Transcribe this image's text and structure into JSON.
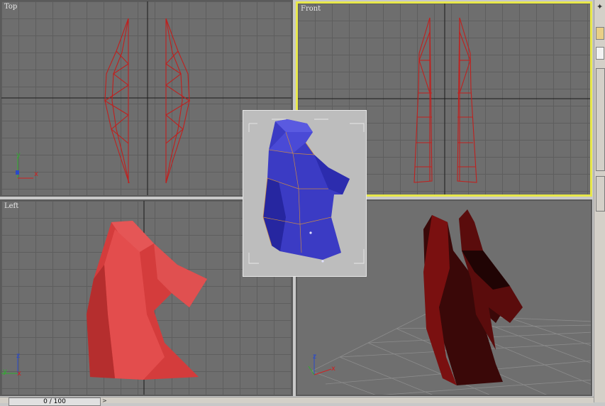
{
  "viewports": {
    "top": {
      "label": "Top"
    },
    "front": {
      "label": "Front"
    },
    "left": {
      "label": "Left"
    },
    "perspective": {
      "label": ""
    }
  },
  "axes": {
    "top": {
      "v": "y",
      "h": "x"
    },
    "left": {
      "v": "z",
      "h": "y"
    },
    "perspective": {
      "v": "z",
      "h": "x"
    }
  },
  "timeslider": {
    "value": "0 / 100"
  },
  "colors": {
    "active_border": "#e8e84a",
    "wire": "#c0201e",
    "red_model": "#d94040",
    "blue_model": "#3b3bc4",
    "dark_model": "#4a0a0a"
  }
}
